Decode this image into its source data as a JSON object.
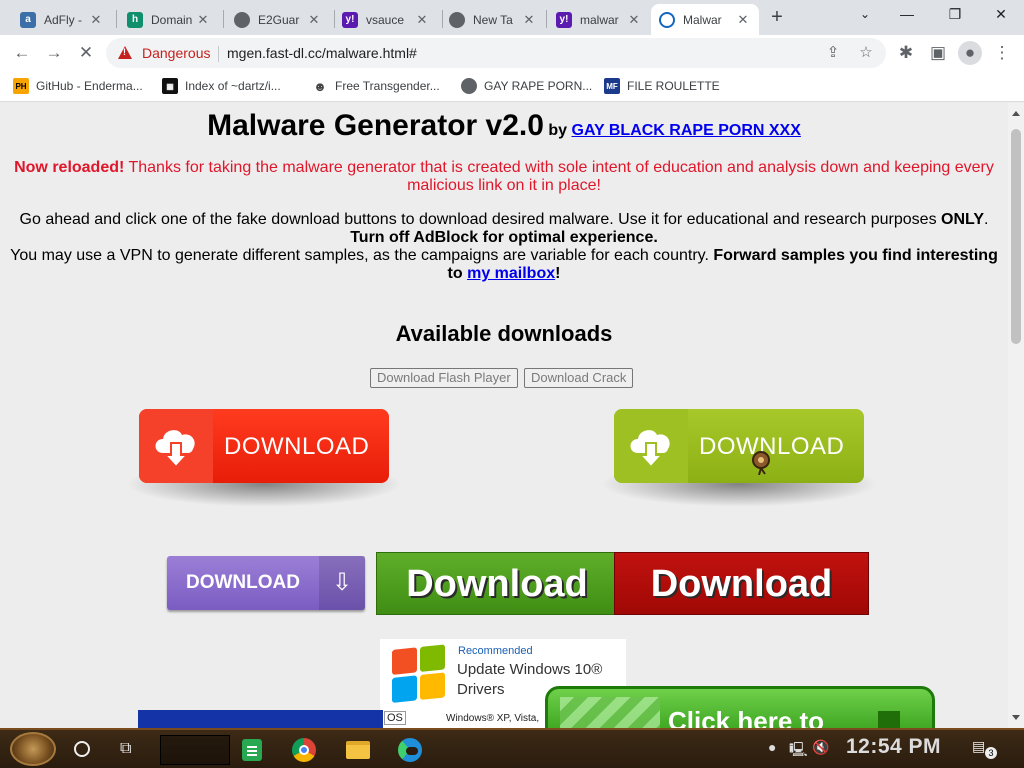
{
  "browser": {
    "tabs": [
      {
        "title": "AdFly -",
        "fav_color": "#3c6ea8",
        "fav_glyph": "a"
      },
      {
        "title": "Domain",
        "fav_color": "#0f8f6b",
        "fav_glyph": "h"
      },
      {
        "title": "E2Guar",
        "fav_color": "#5f6368",
        "fav_glyph": "◉"
      },
      {
        "title": "vsauce",
        "fav_color": "#5c1bb0",
        "fav_glyph": "y!"
      },
      {
        "title": "New Ta",
        "fav_color": "#5f6368",
        "fav_glyph": "◉"
      },
      {
        "title": "malwar",
        "fav_color": "#5c1bb0",
        "fav_glyph": "y!"
      },
      {
        "title": "Malwar",
        "fav_color": "#1565c0",
        "fav_glyph": "◐"
      }
    ],
    "security_label": "Dangerous",
    "url": "mgen.fast-dl.cc/malware.html#",
    "bookmarks": [
      {
        "label": "GitHub - Enderma...",
        "fav_color": "#f7a400",
        "fav_glyph": "PH"
      },
      {
        "label": "Index of ~dartz/i...",
        "fav_color": "#111111",
        "fav_glyph": "▦"
      },
      {
        "label": "Free Transgender...",
        "fav_color": "#444444",
        "fav_glyph": "☻"
      },
      {
        "label": "GAY RAPE PORN...",
        "fav_color": "#5f6368",
        "fav_glyph": "◉"
      },
      {
        "label": "FILE ROULETTE",
        "fav_color": "#1b3a8c",
        "fav_glyph": "MF"
      }
    ]
  },
  "page": {
    "title": "Malware Generator v2.0",
    "by": "by",
    "by_link": "GAY BLACK RAPE PORN XXX",
    "notice_strong": "Now reloaded!",
    "notice_rest": "Thanks for taking the malware generator that is created with sole intent of education and analysis down and keeping every malicious link on it in place!",
    "info_line1": "Go ahead and click one of the fake download buttons to download desired malware. Use it for educational and research purposes",
    "info_only": "ONLY",
    "info_adblock": "Turn off AdBlock for optimal experience.",
    "info_vpn": "You may use a VPN to generate different samples, as the campaigns are variable for each country.",
    "info_forward": "Forward samples you find interesting to",
    "info_mailbox": "my mailbox",
    "info_bang": "!",
    "downloads_heading": "Available downloads",
    "btn_flash": "Download Flash Player",
    "btn_crack": "Download Crack",
    "dl_big_label": "DOWNLOAD",
    "dl_purple_label": "DOWNLOAD",
    "dl_bold_label": "Download",
    "ad_recommended": "Recommended",
    "ad_line1": "Update Windows 10®",
    "ad_line2": "Drivers",
    "ad_os": "OS",
    "ad_versions": "Windows® XP, Vista,",
    "click_here": "Click here to"
  },
  "taskbar": {
    "time": "12:54 PM",
    "notif_count": "3"
  },
  "colors": {
    "danger": "#c5221f",
    "red_button": "#f02814",
    "green_button": "#9bbf1e"
  }
}
